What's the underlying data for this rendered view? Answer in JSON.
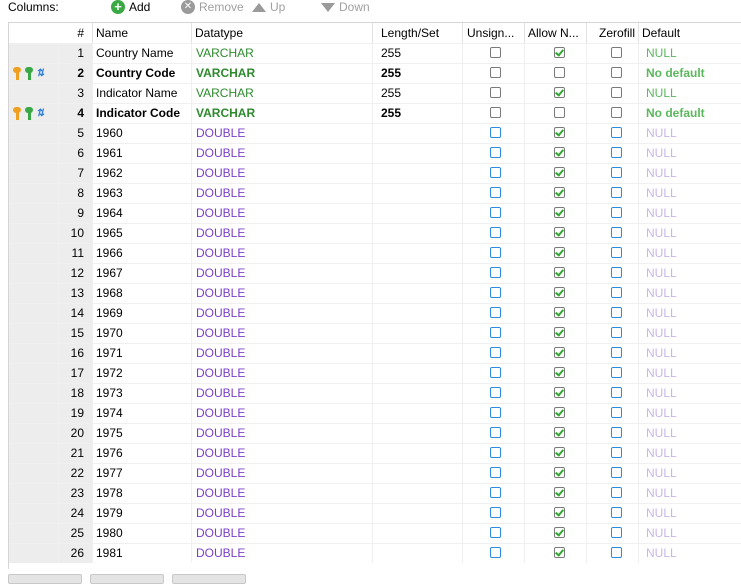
{
  "toolbar": {
    "label": "Columns:",
    "add": "Add",
    "remove": "Remove",
    "up": "Up",
    "down": "Down"
  },
  "headers": [
    "#",
    "Name",
    "Datatype",
    "Length/Set",
    "Unsign...",
    "Allow N...",
    "Zerofill",
    "Default"
  ],
  "rows": [
    {
      "num": "1",
      "name": "Country Name",
      "type": "VARCHAR",
      "length": "255",
      "unsigned": false,
      "allow_null": true,
      "zerofill": false,
      "default": "NULL",
      "bold": false,
      "keys": false
    },
    {
      "num": "2",
      "name": "Country Code",
      "type": "VARCHAR",
      "length": "255",
      "unsigned": false,
      "allow_null": false,
      "zerofill": false,
      "default": "No default",
      "bold": true,
      "keys": true
    },
    {
      "num": "3",
      "name": "Indicator Name",
      "type": "VARCHAR",
      "length": "255",
      "unsigned": false,
      "allow_null": true,
      "zerofill": false,
      "default": "NULL",
      "bold": false,
      "keys": false
    },
    {
      "num": "4",
      "name": "Indicator Code",
      "type": "VARCHAR",
      "length": "255",
      "unsigned": false,
      "allow_null": false,
      "zerofill": false,
      "default": "No default",
      "bold": true,
      "keys": true
    },
    {
      "num": "5",
      "name": "1960",
      "type": "DOUBLE",
      "length": "",
      "unsigned": false,
      "allow_null": true,
      "zerofill": false,
      "default": "NULL",
      "bold": false,
      "keys": false
    },
    {
      "num": "6",
      "name": "1961",
      "type": "DOUBLE",
      "length": "",
      "unsigned": false,
      "allow_null": true,
      "zerofill": false,
      "default": "NULL",
      "bold": false,
      "keys": false
    },
    {
      "num": "7",
      "name": "1962",
      "type": "DOUBLE",
      "length": "",
      "unsigned": false,
      "allow_null": true,
      "zerofill": false,
      "default": "NULL",
      "bold": false,
      "keys": false
    },
    {
      "num": "8",
      "name": "1963",
      "type": "DOUBLE",
      "length": "",
      "unsigned": false,
      "allow_null": true,
      "zerofill": false,
      "default": "NULL",
      "bold": false,
      "keys": false
    },
    {
      "num": "9",
      "name": "1964",
      "type": "DOUBLE",
      "length": "",
      "unsigned": false,
      "allow_null": true,
      "zerofill": false,
      "default": "NULL",
      "bold": false,
      "keys": false
    },
    {
      "num": "10",
      "name": "1965",
      "type": "DOUBLE",
      "length": "",
      "unsigned": false,
      "allow_null": true,
      "zerofill": false,
      "default": "NULL",
      "bold": false,
      "keys": false
    },
    {
      "num": "11",
      "name": "1966",
      "type": "DOUBLE",
      "length": "",
      "unsigned": false,
      "allow_null": true,
      "zerofill": false,
      "default": "NULL",
      "bold": false,
      "keys": false
    },
    {
      "num": "12",
      "name": "1967",
      "type": "DOUBLE",
      "length": "",
      "unsigned": false,
      "allow_null": true,
      "zerofill": false,
      "default": "NULL",
      "bold": false,
      "keys": false
    },
    {
      "num": "13",
      "name": "1968",
      "type": "DOUBLE",
      "length": "",
      "unsigned": false,
      "allow_null": true,
      "zerofill": false,
      "default": "NULL",
      "bold": false,
      "keys": false
    },
    {
      "num": "14",
      "name": "1969",
      "type": "DOUBLE",
      "length": "",
      "unsigned": false,
      "allow_null": true,
      "zerofill": false,
      "default": "NULL",
      "bold": false,
      "keys": false
    },
    {
      "num": "15",
      "name": "1970",
      "type": "DOUBLE",
      "length": "",
      "unsigned": false,
      "allow_null": true,
      "zerofill": false,
      "default": "NULL",
      "bold": false,
      "keys": false
    },
    {
      "num": "16",
      "name": "1971",
      "type": "DOUBLE",
      "length": "",
      "unsigned": false,
      "allow_null": true,
      "zerofill": false,
      "default": "NULL",
      "bold": false,
      "keys": false
    },
    {
      "num": "17",
      "name": "1972",
      "type": "DOUBLE",
      "length": "",
      "unsigned": false,
      "allow_null": true,
      "zerofill": false,
      "default": "NULL",
      "bold": false,
      "keys": false
    },
    {
      "num": "18",
      "name": "1973",
      "type": "DOUBLE",
      "length": "",
      "unsigned": false,
      "allow_null": true,
      "zerofill": false,
      "default": "NULL",
      "bold": false,
      "keys": false
    },
    {
      "num": "19",
      "name": "1974",
      "type": "DOUBLE",
      "length": "",
      "unsigned": false,
      "allow_null": true,
      "zerofill": false,
      "default": "NULL",
      "bold": false,
      "keys": false
    },
    {
      "num": "20",
      "name": "1975",
      "type": "DOUBLE",
      "length": "",
      "unsigned": false,
      "allow_null": true,
      "zerofill": false,
      "default": "NULL",
      "bold": false,
      "keys": false
    },
    {
      "num": "21",
      "name": "1976",
      "type": "DOUBLE",
      "length": "",
      "unsigned": false,
      "allow_null": true,
      "zerofill": false,
      "default": "NULL",
      "bold": false,
      "keys": false
    },
    {
      "num": "22",
      "name": "1977",
      "type": "DOUBLE",
      "length": "",
      "unsigned": false,
      "allow_null": true,
      "zerofill": false,
      "default": "NULL",
      "bold": false,
      "keys": false
    },
    {
      "num": "23",
      "name": "1978",
      "type": "DOUBLE",
      "length": "",
      "unsigned": false,
      "allow_null": true,
      "zerofill": false,
      "default": "NULL",
      "bold": false,
      "keys": false
    },
    {
      "num": "24",
      "name": "1979",
      "type": "DOUBLE",
      "length": "",
      "unsigned": false,
      "allow_null": true,
      "zerofill": false,
      "default": "NULL",
      "bold": false,
      "keys": false
    },
    {
      "num": "25",
      "name": "1980",
      "type": "DOUBLE",
      "length": "",
      "unsigned": false,
      "allow_null": true,
      "zerofill": false,
      "default": "NULL",
      "bold": false,
      "keys": false
    },
    {
      "num": "26",
      "name": "1981",
      "type": "DOUBLE",
      "length": "",
      "unsigned": false,
      "allow_null": true,
      "zerofill": false,
      "default": "NULL",
      "bold": false,
      "keys": false
    }
  ],
  "colors": {
    "varchar": "#2d8a2d",
    "double": "#7a3fc9",
    "default_green": "#5cb85c",
    "default_grey_purple": "#c9b6e6",
    "checkbox_blue": "#2c8de0",
    "check_green": "#2fa82f",
    "key_orange": "#f0a020",
    "key_green": "#3aa845"
  },
  "icons": {
    "add": "plus-circle-icon",
    "remove": "x-circle-icon",
    "up": "triangle-up-icon",
    "down": "triangle-down-icon",
    "primary_key": "key-icon",
    "foreign_key": "foreign-key-icon"
  }
}
